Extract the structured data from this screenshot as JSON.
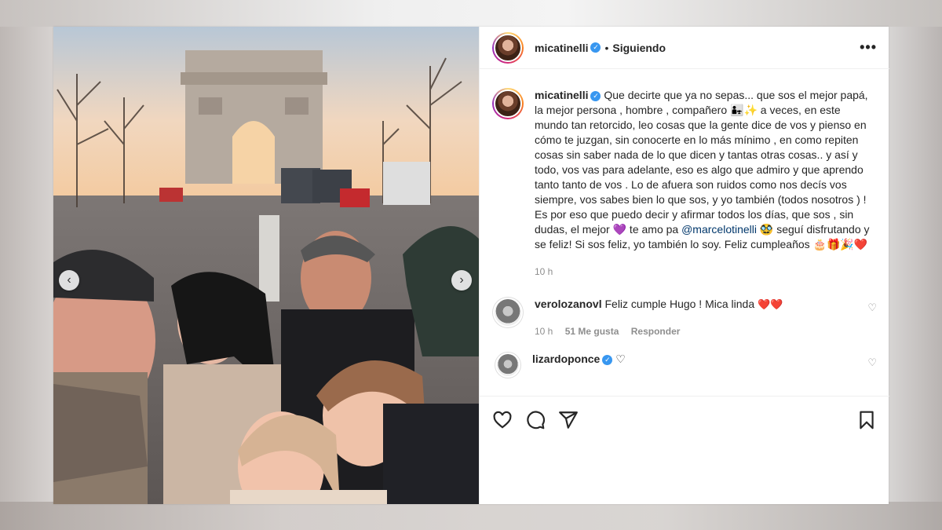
{
  "post": {
    "username": "micatinelli",
    "follow_status": "Siguiendo",
    "more_label": "•••",
    "carousel_prev": "‹",
    "carousel_next": "›",
    "caption_text": "Que decirte que ya no sepas... que sos el mejor papá, la mejor persona , hombre , compañero 👨‍👧✨ a veces, en este mundo tan retorcido, leo cosas que la gente dice de vos y pienso en cómo te juzgan, sin conocerte en lo más mínimo , en como repiten cosas sin saber nada de lo que dicen y tantas otras cosas.. y así y todo, vos vas para adelante, eso es algo que admiro y que aprendo tanto tanto de vos . Lo de afuera son ruidos como nos decís vos siempre, vos sabes bien lo que sos, y yo también (todos nosotros ) ! Es por eso que puedo decir y afirmar todos los días, que sos , sin dudas, el mejor 💜 te amo pa",
    "caption_mention": "@marcelotinelli",
    "caption_tail": "🥸 seguí disfrutando y se feliz! Si sos feliz, yo también lo soy. Feliz cumpleaños 🎂🎁🎉❤️",
    "caption_time": "10 h"
  },
  "comments": [
    {
      "username": "verolozanovl",
      "text": "Feliz cumple Hugo ! Mica linda",
      "emoji": "❤️❤️",
      "time": "10 h",
      "likes": "51 Me gusta",
      "reply": "Responder"
    },
    {
      "username": "lizardoponce",
      "text": "♡"
    }
  ],
  "colors": {
    "accent": "#3897f0",
    "mention": "#00376b",
    "secondary_text": "#8e8e8e"
  }
}
